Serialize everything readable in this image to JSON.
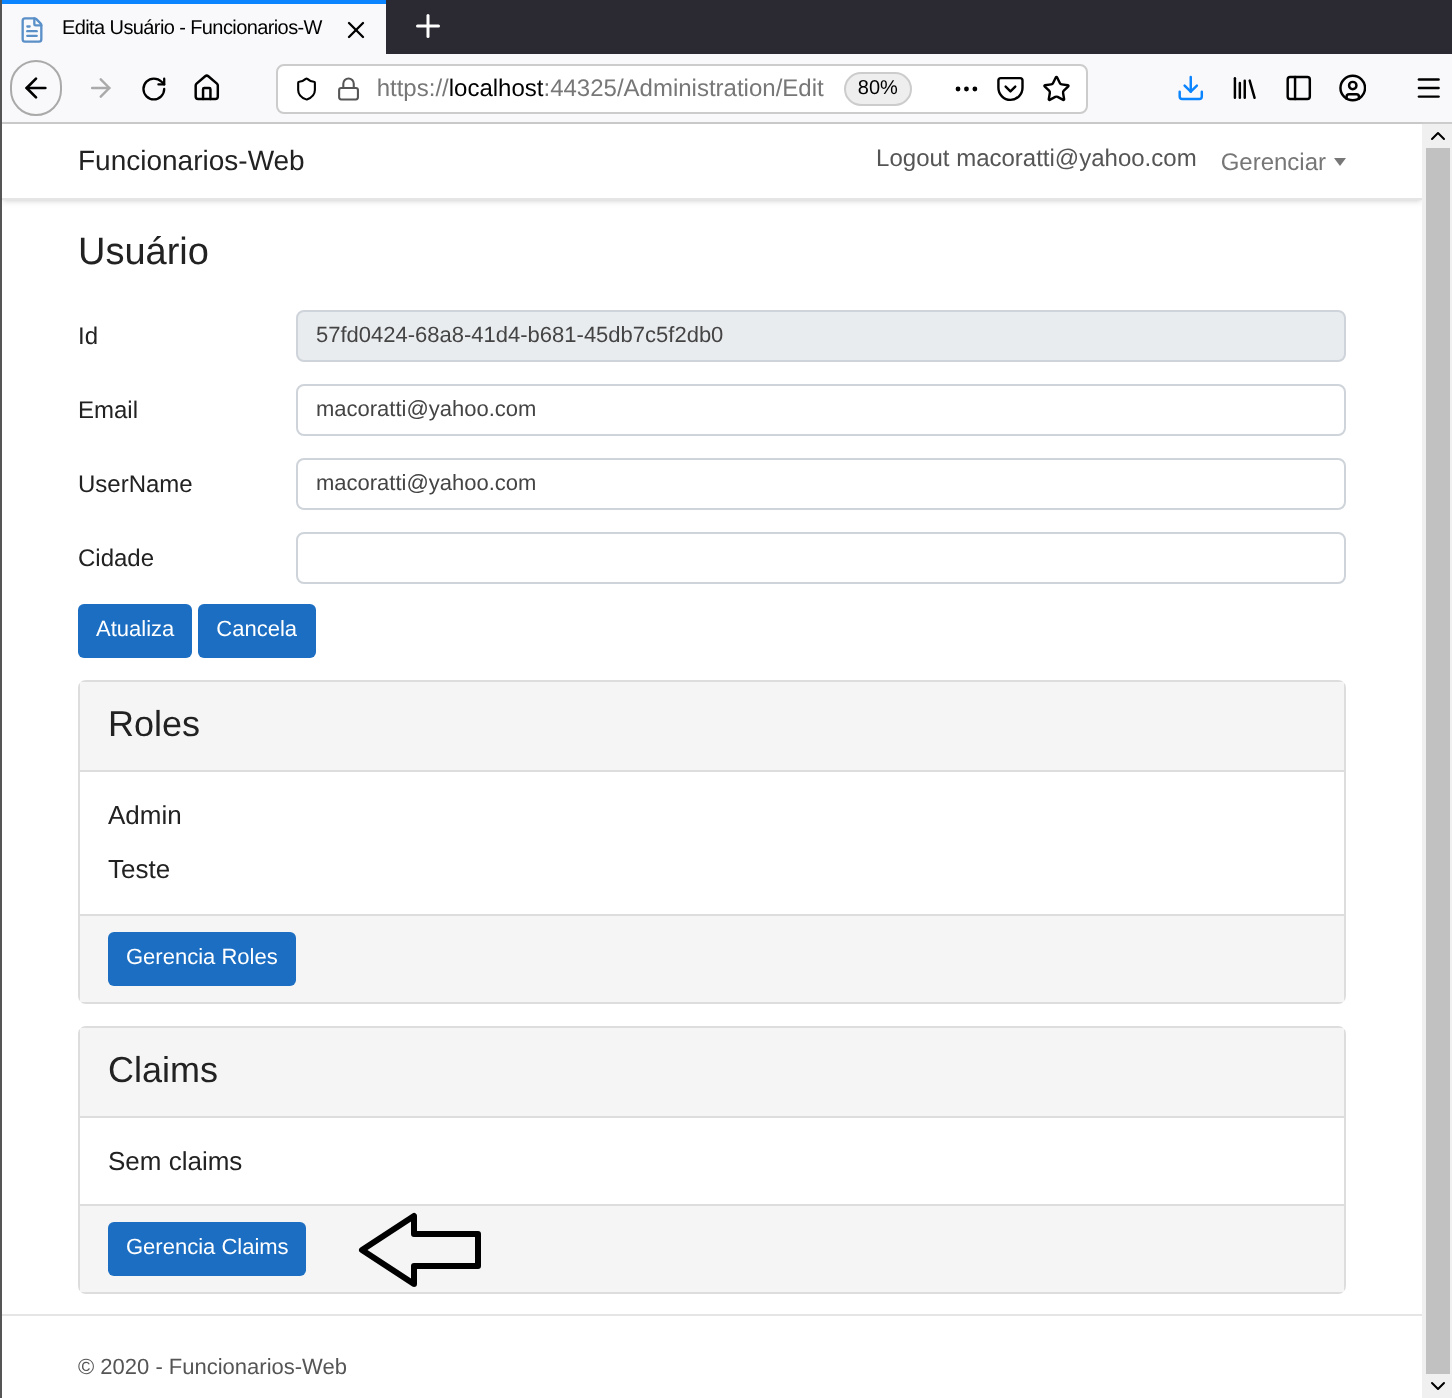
{
  "browser": {
    "tab_title": "Edita Usuário - Funcionarios-W",
    "url_host": "localhost",
    "url_scheme": "https://",
    "url_rest": ":44325/Administration/Edit",
    "zoom": "80%"
  },
  "navbar": {
    "brand": "Funcionarios-Web",
    "logout": "Logout macoratti@yahoo.com",
    "menu": "Gerenciar"
  },
  "title": "Usuário",
  "fields": [
    {
      "label": "Id",
      "value": "57fd0424-68a8-41d4-b681-45db7c5f2db0",
      "disabled": true
    },
    {
      "label": "Email",
      "value": "macoratti@yahoo.com",
      "disabled": false
    },
    {
      "label": "UserName",
      "value": "macoratti@yahoo.com",
      "disabled": false
    },
    {
      "label": "Cidade",
      "disabled": false
    }
  ],
  "buttons": [
    "Atualiza",
    "Cancela"
  ],
  "cards": [
    {
      "title": "Roles",
      "items": [
        "Admin",
        "Teste"
      ],
      "button": "Gerencia Roles",
      "arrow": false
    },
    {
      "title": "Claims",
      "items": [
        "Sem claims"
      ],
      "button": "Gerencia Claims",
      "arrow": true
    }
  ],
  "footer": "© 2020 - Funcionarios-Web"
}
